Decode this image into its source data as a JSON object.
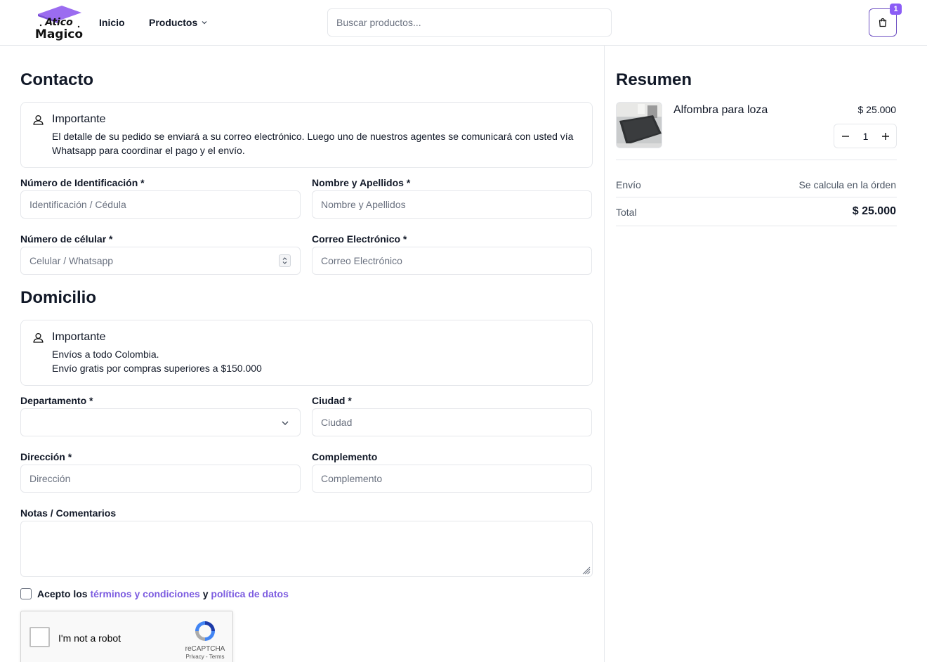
{
  "brand": {
    "logo_line1": "Atico",
    "logo_line2": "Magico"
  },
  "nav": {
    "home": "Inicio",
    "products": "Productos"
  },
  "search": {
    "placeholder": "Buscar productos..."
  },
  "cart": {
    "count": "1"
  },
  "contact": {
    "title": "Contacto",
    "notice": {
      "title": "Importante",
      "body": "El detalle de su pedido se enviará a su correo electrónico. Luego uno de nuestros agentes se comunicará con usted vía Whatsapp para coordinar el pago y el envío."
    },
    "id_label": "Número de Identificación *",
    "id_placeholder": "Identificación / Cédula",
    "name_label": "Nombre y Apellidos *",
    "name_placeholder": "Nombre y Apellidos",
    "phone_label": "Número de célular *",
    "phone_placeholder": "Celular / Whatsapp",
    "email_label": "Correo Electrónico *",
    "email_placeholder": "Correo Electrónico"
  },
  "address": {
    "title": "Domicilio",
    "notice": {
      "title": "Importante",
      "line1": "Envíos a todo Colombia.",
      "line2": "Envío gratis por compras superiores a $150.000"
    },
    "dept_label": "Departamento *",
    "dept_value": "",
    "city_label": "Ciudad *",
    "city_placeholder": "Ciudad",
    "address_label": "Dirección *",
    "address_placeholder": "Dirección",
    "complement_label": "Complemento",
    "complement_placeholder": "Complemento",
    "notes_label": "Notas / Comentarios"
  },
  "terms": {
    "prefix": "Acepto los",
    "terms_link": "términos y condiciones",
    "joiner": "y",
    "privacy_link": "política de datos"
  },
  "captcha": {
    "label": "I'm not a robot",
    "brand": "reCAPTCHA",
    "links": "Privacy - Terms"
  },
  "summary": {
    "title": "Resumen",
    "item": {
      "name": "Alfombra para loza",
      "price": "$ 25.000",
      "quantity": "1"
    },
    "shipping_label": "Envío",
    "shipping_value": "Se calcula en la órden",
    "total_label": "Total",
    "total_value": "$ 25.000"
  },
  "colors": {
    "accent": "#7c5ce0",
    "border": "#e5e7eb",
    "badge": "#8b5cf6"
  }
}
